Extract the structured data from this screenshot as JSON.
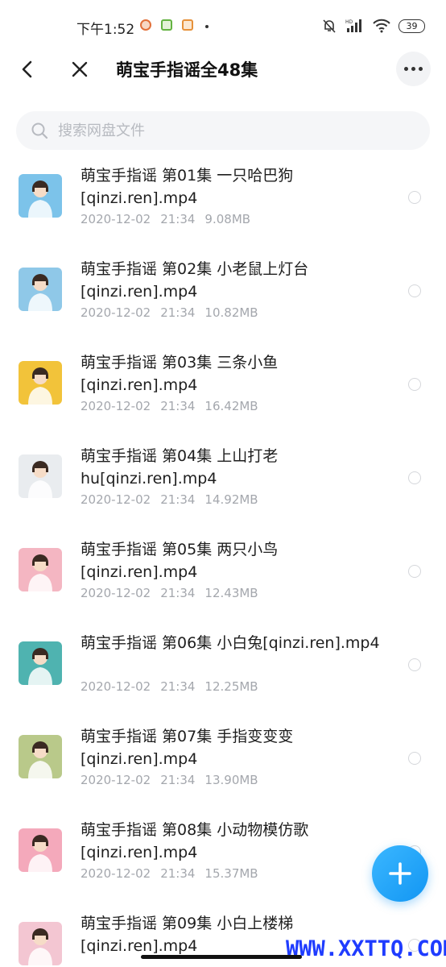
{
  "status_bar": {
    "time": "下午1:52",
    "battery": "39",
    "signal_label": "HD"
  },
  "header": {
    "title": "萌宝手指谣全48集",
    "back_icon": "chevron-left-icon",
    "close_icon": "close-icon",
    "more_icon": "more-dots-icon"
  },
  "search": {
    "placeholder": "搜索网盘文件",
    "icon": "search-icon"
  },
  "files": [
    {
      "name": "萌宝手指谣 第01集 一只哈巴狗[qinzi.ren].mp4",
      "date": "2020-12-02",
      "time": "21:34",
      "size": "9.08MB"
    },
    {
      "name": "萌宝手指谣 第02集 小老鼠上灯台[qinzi.ren].mp4",
      "date": "2020-12-02",
      "time": "21:34",
      "size": "10.82MB"
    },
    {
      "name": "萌宝手指谣 第03集 三条小鱼[qinzi.ren].mp4",
      "date": "2020-12-02",
      "time": "21:34",
      "size": "16.42MB"
    },
    {
      "name": "萌宝手指谣 第04集 上山打老hu[qinzi.ren].mp4",
      "date": "2020-12-02",
      "time": "21:34",
      "size": "14.92MB"
    },
    {
      "name": "萌宝手指谣 第05集 两只小鸟[qinzi.ren].mp4",
      "date": "2020-12-02",
      "time": "21:34",
      "size": "12.43MB"
    },
    {
      "name": "萌宝手指谣 第06集 小白兔[qinzi.ren].mp4",
      "date": "2020-12-02",
      "time": "21:34",
      "size": "12.25MB"
    },
    {
      "name": "萌宝手指谣 第07集 手指变变变[qinzi.ren].mp4",
      "date": "2020-12-02",
      "time": "21:34",
      "size": "13.90MB"
    },
    {
      "name": "萌宝手指谣 第08集 小动物模仿歌[qinzi.ren].mp4",
      "date": "2020-12-02",
      "time": "21:34",
      "size": "15.37MB"
    },
    {
      "name": "萌宝手指谣 第09集 小白上楼梯[qinzi.ren].mp4",
      "date": "",
      "time": "",
      "size": ""
    }
  ],
  "thumb_colors": [
    "#7cc3ea",
    "#8fc8e8",
    "#f2c33a",
    "#e9ecef",
    "#f4b6c2",
    "#4fb3b0",
    "#b9c98a",
    "#f4a9bb",
    "#f3c6d2"
  ],
  "fab": {
    "icon": "plus-icon"
  },
  "watermark": "WWW.XXTTQ.COM",
  "accent": "#1296f3"
}
